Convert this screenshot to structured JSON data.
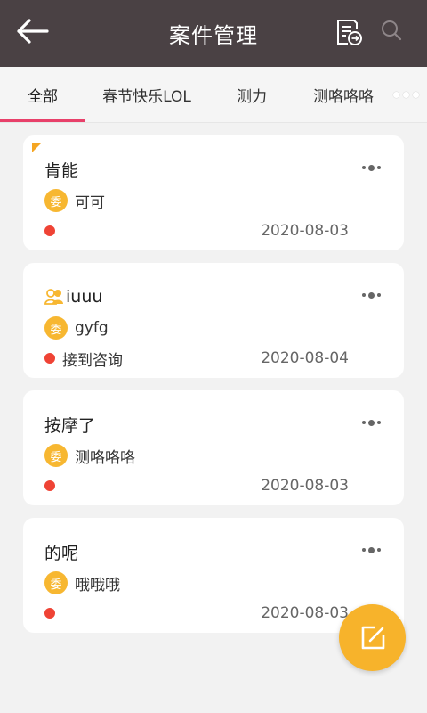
{
  "header": {
    "title": "案件管理",
    "icons": [
      "back-arrow-icon",
      "document-export-icon",
      "search-icon"
    ]
  },
  "tabs": [
    {
      "label": "全部",
      "active": true
    },
    {
      "label": "春节快乐LOL",
      "active": false
    },
    {
      "label": "测力",
      "active": false
    },
    {
      "label": "测咯咯咯",
      "active": false
    }
  ],
  "cases": [
    {
      "title": "肯能",
      "badge": "委",
      "client": "可可",
      "status": "",
      "date": "2020-08-03",
      "flagged": true,
      "group_icon": false
    },
    {
      "title": "iuuu",
      "badge": "委",
      "client": "gyfg",
      "status": "接到咨询",
      "date": "2020-08-04",
      "flagged": false,
      "group_icon": true
    },
    {
      "title": "按摩了",
      "badge": "委",
      "client": "测咯咯咯",
      "status": "",
      "date": "2020-08-03",
      "flagged": false,
      "group_icon": false
    },
    {
      "title": "的呢",
      "badge": "委",
      "client": "哦哦哦",
      "status": "",
      "date": "2020-08-03",
      "flagged": false,
      "group_icon": false
    }
  ],
  "colors": {
    "header_bg": "#4a4144",
    "tab_indicator": "#e8406a",
    "badge": "#f7b731",
    "status_dot": "#ef4335",
    "fab": "#f7b32b",
    "corner_flag": "#f5a623"
  }
}
